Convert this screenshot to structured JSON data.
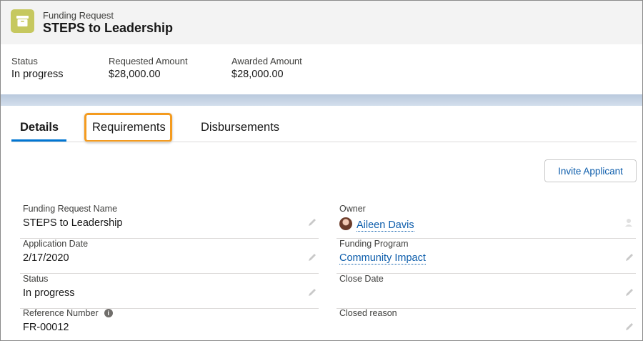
{
  "header": {
    "object_type": "Funding Request",
    "record_title": "STEPS to Leadership",
    "icon": "archive-box-icon",
    "icon_color": "#c6c85f"
  },
  "highlights": [
    {
      "label": "Status",
      "value": "In progress"
    },
    {
      "label": "Requested Amount",
      "value": "$28,000.00"
    },
    {
      "label": "Awarded Amount",
      "value": "$28,000.00"
    }
  ],
  "tabs": [
    {
      "label": "Details",
      "active": true
    },
    {
      "label": "Requirements",
      "active": false
    },
    {
      "label": "Disbursements",
      "active": false
    }
  ],
  "actions": {
    "invite_label": "Invite Applicant"
  },
  "fields_left": [
    {
      "label": "Funding Request Name",
      "value": "STEPS to Leadership"
    },
    {
      "label": "Application Date",
      "value": "2/17/2020"
    },
    {
      "label": "Status",
      "value": "In progress"
    },
    {
      "label": "Reference Number",
      "value": "FR-00012"
    }
  ],
  "fields_right": [
    {
      "label": "Owner",
      "value": "Aileen Davis"
    },
    {
      "label": "Funding Program",
      "value": "Community Impact"
    },
    {
      "label": "Close Date",
      "value": ""
    },
    {
      "label": "Closed reason",
      "value": ""
    }
  ],
  "colors": {
    "accent": "#0176d3",
    "link": "#0b5cab",
    "focus_highlight": "#f49b1f"
  }
}
